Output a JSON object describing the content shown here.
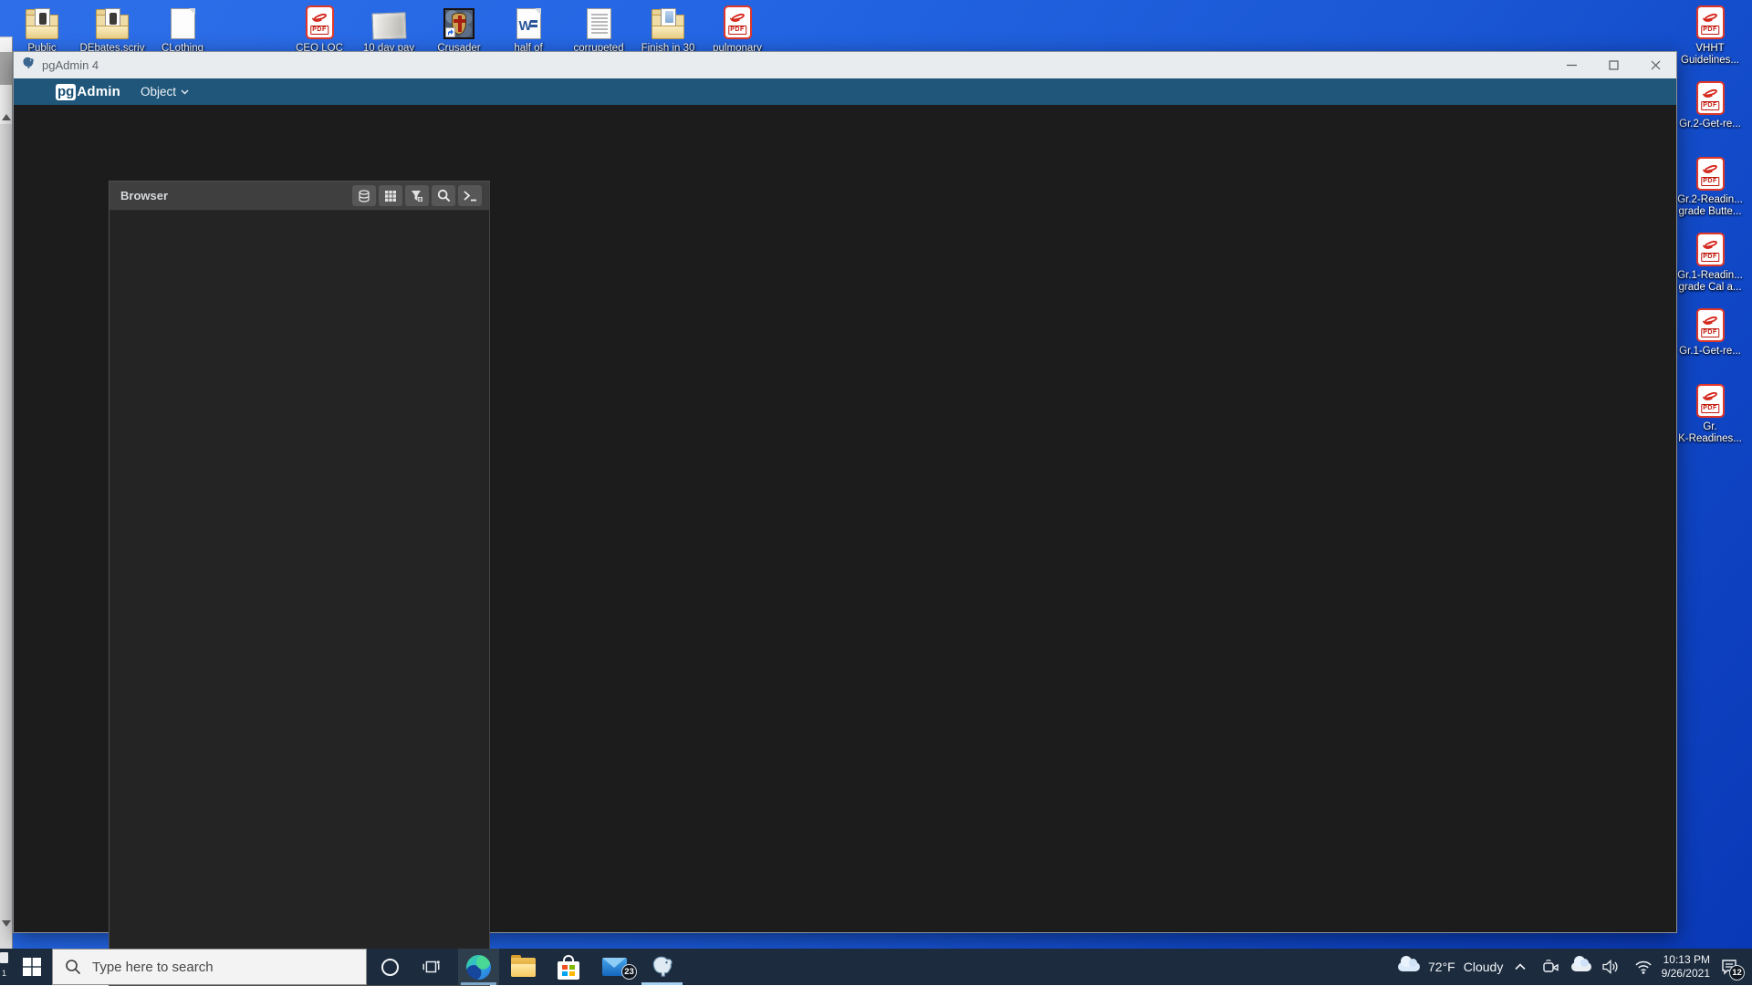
{
  "icons": {
    "pdf_label": "PDF",
    "word_letter": "W"
  },
  "desktop": {
    "top_icons": [
      {
        "label": "Public"
      },
      {
        "label": "DEbates.scriv"
      },
      {
        "label": "CLothing"
      },
      {
        "label": "CEO LOC"
      },
      {
        "label": "10 day pay"
      },
      {
        "label": "Crusader"
      },
      {
        "label": "half of"
      },
      {
        "label": "corrupeted"
      },
      {
        "label": "Finish in 30"
      },
      {
        "label": "pulmonary"
      }
    ],
    "right_icons": [
      {
        "lines": [
          "VHHT",
          "Guidelines..."
        ]
      },
      {
        "lines": [
          "Gr.2-Get-re..."
        ]
      },
      {
        "lines": [
          "Gr.2-Readin...",
          "grade Butte..."
        ]
      },
      {
        "lines": [
          "Gr.1-Readin...",
          "grade Cal a..."
        ]
      },
      {
        "lines": [
          "Gr.1-Get-re..."
        ]
      },
      {
        "lines": [
          "Gr.",
          "K-Readines..."
        ]
      }
    ]
  },
  "window": {
    "title": "pgAdmin 4",
    "logo": {
      "pg": "pg",
      "admin": "Admin"
    },
    "menu": {
      "object": "Object"
    },
    "browser": {
      "title": "Browser"
    }
  },
  "taskbar": {
    "overflow_label": "1",
    "search_placeholder": "Type here to search",
    "mail_badge": "23",
    "tray": {
      "temp": "72°F",
      "condition": "Cloudy",
      "time": "10:13 PM",
      "date": "9/26/2021",
      "notification_badge": "12"
    }
  }
}
